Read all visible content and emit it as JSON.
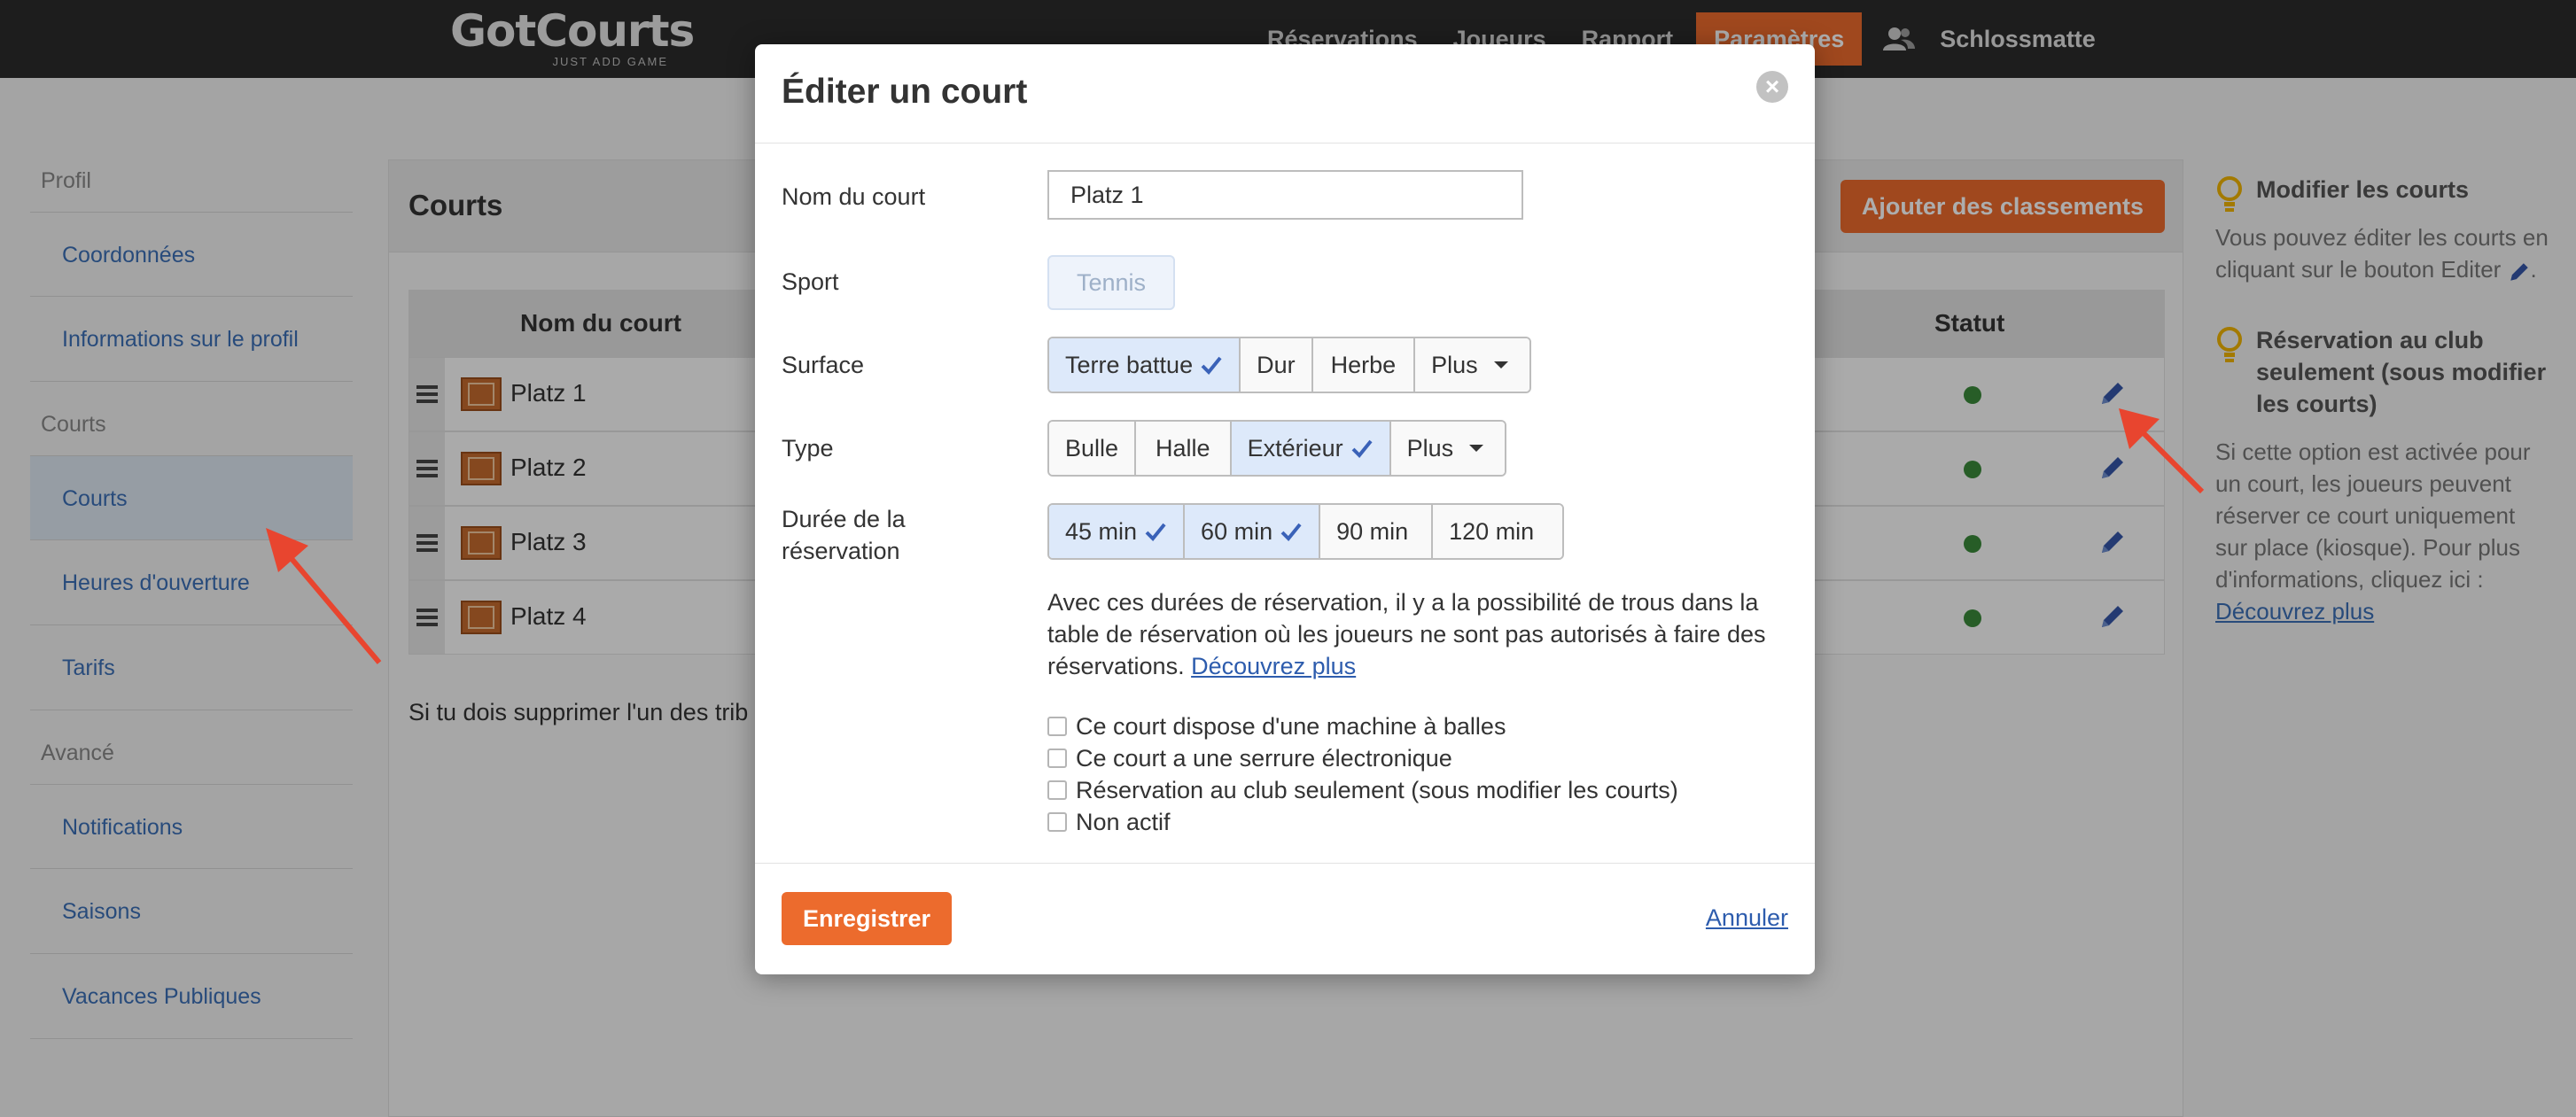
{
  "nav": {
    "logo": "GotCourts",
    "tagline": "JUST ADD GAME",
    "links": [
      "Réservations",
      "Joueurs",
      "Rapport",
      "Paramètres"
    ],
    "active_link": "Paramètres",
    "club": "Schlossmatte"
  },
  "sidebar": {
    "sections": [
      {
        "title": "Profil",
        "items": [
          "Coordonnées",
          "Informations sur le profil"
        ]
      },
      {
        "title": "Courts",
        "items": [
          "Courts",
          "Heures d'ouverture",
          "Tarifs"
        ]
      },
      {
        "title": "Avancé",
        "items": [
          "Notifications",
          "Saisons",
          "Vacances Publiques"
        ]
      }
    ],
    "active_item": "Courts"
  },
  "main": {
    "title": "Courts",
    "add_button": "Ajouter des classements",
    "columns": {
      "name": "Nom du court",
      "status": "Statut"
    },
    "rows": [
      {
        "name": "Platz 1",
        "status": "active"
      },
      {
        "name": "Platz 2",
        "status": "active"
      },
      {
        "name": "Platz 3",
        "status": "active"
      },
      {
        "name": "Platz 4",
        "status": "active"
      }
    ],
    "info_text": "Si tu dois supprimer l'un des trib"
  },
  "help": {
    "items": [
      {
        "title": "Modifier les courts",
        "body": "Vous pouvez éditer les courts en cliquant sur le bouton Editer"
      },
      {
        "title": "Réservation au club seulement (sous modifier les courts)",
        "body": "Si cette option est activée pour un court, les joueurs peuvent réserver ce court uniquement sur place (kiosque). Pour plus d'informations, cliquez ici :",
        "link": "Découvrez plus"
      }
    ]
  },
  "modal": {
    "title": "Éditer un court",
    "close": "×",
    "labels": {
      "name": "Nom du court",
      "sport": "Sport",
      "surface": "Surface",
      "type": "Type",
      "duration_line1": "Durée de la",
      "duration_line2": "réservation"
    },
    "name_value": "Platz 1",
    "sport_value": "Tennis",
    "surface_options": [
      {
        "label": "Terre battue",
        "selected": true
      },
      {
        "label": "Dur",
        "selected": false
      },
      {
        "label": "Herbe",
        "selected": false
      },
      {
        "label": "Plus",
        "selected": false,
        "dropdown": true
      }
    ],
    "type_options": [
      {
        "label": "Bulle",
        "selected": false
      },
      {
        "label": "Halle",
        "selected": false
      },
      {
        "label": "Extérieur",
        "selected": true
      },
      {
        "label": "Plus",
        "selected": false,
        "dropdown": true
      }
    ],
    "duration_options": [
      {
        "label": "45 min",
        "selected": true
      },
      {
        "label": "60 min",
        "selected": true
      },
      {
        "label": "90 min",
        "selected": false
      },
      {
        "label": "120 min",
        "selected": false
      }
    ],
    "note": "Avec ces durées de réservation, il y a la possibilité de trous dans la table de réservation où les joueurs ne sont pas autorisés à faire des réservations.",
    "note_link": "Découvrez plus",
    "checkboxes": [
      {
        "label": "Ce court dispose d'une machine à balles",
        "checked": false
      },
      {
        "label": "Ce court a une serrure électronique",
        "checked": false
      },
      {
        "label": "Réservation au club seulement (sous modifier les courts)",
        "checked": false
      },
      {
        "label": "Non actif",
        "checked": false
      }
    ],
    "save": "Enregistrer",
    "cancel": "Annuler"
  },
  "colors": {
    "accent": "#ec6b2d",
    "link": "#3b6fb6",
    "selected": "#dde9fa",
    "arrow": "#e8452f"
  }
}
